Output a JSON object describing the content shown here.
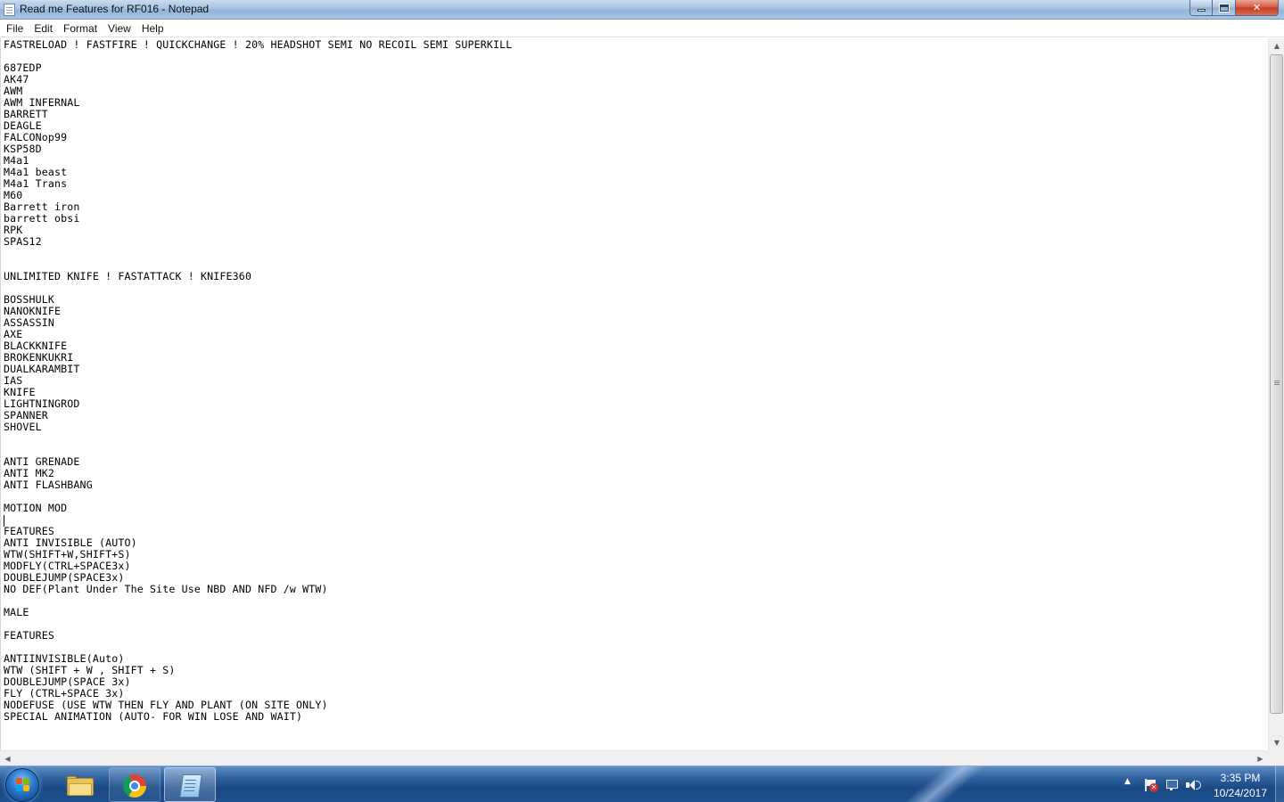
{
  "window": {
    "title": "Read me Features for RF016 - Notepad"
  },
  "menu": {
    "items": [
      "File",
      "Edit",
      "Format",
      "View",
      "Help"
    ]
  },
  "editor": {
    "lines": [
      "FASTRELOAD ! FASTFIRE ! QUICKCHANGE ! 20% HEADSHOT SEMI NO RECOIL SEMI SUPERKILL",
      "",
      "687EDP",
      "AK47",
      "AWM",
      "AWM INFERNAL",
      "BARRETT",
      "DEAGLE",
      "FALCONop99",
      "KSP58D",
      "M4a1",
      "M4a1 beast",
      "M4a1 Trans",
      "M60",
      "Barrett iron",
      "barrett obsi",
      "RPK",
      "SPAS12",
      "",
      "",
      "UNLIMITED KNIFE ! FASTATTACK ! KNIFE360",
      "",
      "BOSSHULK",
      "NANOKNIFE",
      "ASSASSIN",
      "AXE",
      "BLACKKNIFE",
      "BROKENKUKRI",
      "DUALKARAMBIT",
      "IAS",
      "KNIFE",
      "LIGHTNINGROD",
      "SPANNER",
      "SHOVEL",
      "",
      "",
      "ANTI GRENADE",
      "ANTI MK2",
      "ANTI FLASHBANG",
      "",
      "MOTION MOD",
      "",
      "FEATURES",
      "ANTI INVISIBLE (AUTO)",
      "WTW(SHIFT+W,SHIFT+S)",
      "MODFLY(CTRL+SPACE3x)",
      "DOUBLEJUMP(SPACE3x)",
      "NO DEF(Plant Under The Site Use NBD AND NFD /w WTW)",
      "",
      "MALE",
      "",
      "FEATURES",
      "",
      "ANTIINVISIBLE(Auto)",
      "WTW (SHIFT + W , SHIFT + S)",
      "DOUBLEJUMP(SPACE 3x)",
      "FLY (CTRL+SPACE 3x)",
      "NODEFUSE (USE WTW THEN FLY AND PLANT (ON SITE ONLY)",
      "SPECIAL ANIMATION (AUTO- FOR WIN LOSE AND WAIT)"
    ]
  },
  "taskbar": {
    "pinned": [
      "windows-explorer",
      "google-chrome",
      "notepad"
    ],
    "active": "notepad"
  },
  "clock": {
    "time": "3:35 PM",
    "date": "10/24/2017"
  },
  "icons": {
    "caption_minimize": "minimize-icon",
    "caption_maximize": "maximize-icon",
    "caption_close": "close-icon",
    "tray": [
      "show-hidden-icons-chevron",
      "action-center-flag-icon",
      "network-icon",
      "volume-icon"
    ]
  },
  "glyphs": {
    "close": "✕",
    "scroll_up": "▲",
    "scroll_down": "▼",
    "scroll_left": "◀",
    "scroll_right": "▶",
    "tray_chevron": "▲",
    "flag_x": "✕"
  },
  "colors": {
    "taskbar": "#1b4a85",
    "close_button": "#c33c22",
    "text": "#000000"
  }
}
